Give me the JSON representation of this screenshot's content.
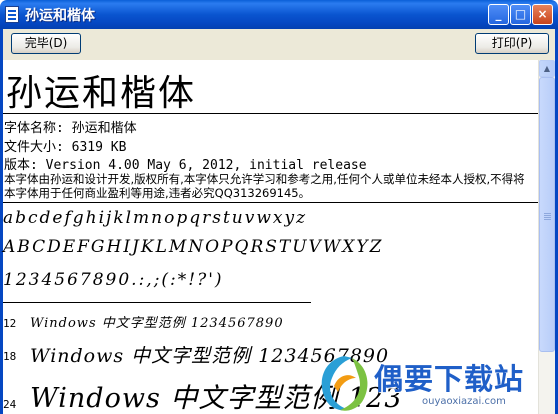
{
  "window": {
    "title": "孙运和楷体",
    "controls": {
      "minimize": "_",
      "maximize": "□",
      "close": "×"
    }
  },
  "toolbar": {
    "done_label": "完毕(D)",
    "print_label": "打印(P)"
  },
  "preview": {
    "font_title": "孙运和楷体",
    "font_name_line": "字体名称: 孙运和楷体",
    "file_size_line": "文件大小: 6319 KB",
    "version_line": "版本: Version 4.00 May 6, 2012, initial release",
    "copyright_text": "本字体由孙运和设计开发,版权所有,本字体只允许学习和参考之用,任何个人或单位未经本人授权,不得将本字体用于任何商业盈利等用途,违者必究QQ313269145。",
    "lowercase_sample": "abcdefghijklmnopqrstuvwxyz",
    "uppercase_sample": "ABCDEFGHIJKLMNOPQRSTUVWXYZ",
    "digits_sample": "1234567890.:,;(:*!?')",
    "size_samples": [
      {
        "size": "12",
        "text": "Windows 中文字型范例 1234567890"
      },
      {
        "size": "18",
        "text": "Windows 中文字型范例 1234567890"
      },
      {
        "size": "24",
        "text": "Windows 中文字型范例 123"
      }
    ]
  },
  "watermark": {
    "logo_text": "偶要下载站",
    "url": "ouyaoxiazai.com"
  }
}
